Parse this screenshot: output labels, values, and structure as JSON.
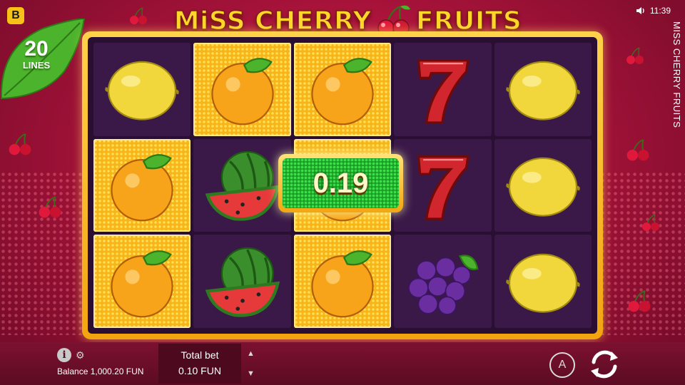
{
  "brand": {
    "badge": "B"
  },
  "lines": {
    "count": "20",
    "label": "LINES"
  },
  "title": {
    "part1": "MiSS CHERRY",
    "part2": "FRUITS"
  },
  "status": {
    "time": "11:39",
    "sound_icon": "speaker-icon"
  },
  "side_title": "MISS CHERRY FRUITS",
  "reels": [
    [
      {
        "symbol": "lemon",
        "win": false
      },
      {
        "symbol": "orange",
        "win": true
      },
      {
        "symbol": "orange",
        "win": true
      }
    ],
    [
      {
        "symbol": "orange",
        "win": true
      },
      {
        "symbol": "watermelon",
        "win": false
      },
      {
        "symbol": "watermelon",
        "win": false
      }
    ],
    [
      {
        "symbol": "orange",
        "win": true
      },
      {
        "symbol": "orange",
        "win": true
      },
      {
        "symbol": "orange",
        "win": true
      }
    ],
    [
      {
        "symbol": "seven",
        "win": false
      },
      {
        "symbol": "seven",
        "win": false
      },
      {
        "symbol": "grapes",
        "win": false
      }
    ],
    [
      {
        "symbol": "lemon",
        "win": false
      },
      {
        "symbol": "lemon",
        "win": false
      },
      {
        "symbol": "lemon",
        "win": false
      }
    ]
  ],
  "win_amount": "0.19",
  "bottom": {
    "info_icon": "info-icon",
    "settings_icon": "gear-icon",
    "balance": "Balance 1,000.20 FUN",
    "total_bet_label": "Total bet",
    "total_bet_value": "0.10 FUN",
    "auto_label": "A",
    "spin_icon": "spin-icon"
  },
  "colors": {
    "background": "#a8133a",
    "frame_gold": "#f2a40f",
    "title_yellow": "#ffd629",
    "win_green": "#1a9d25"
  }
}
